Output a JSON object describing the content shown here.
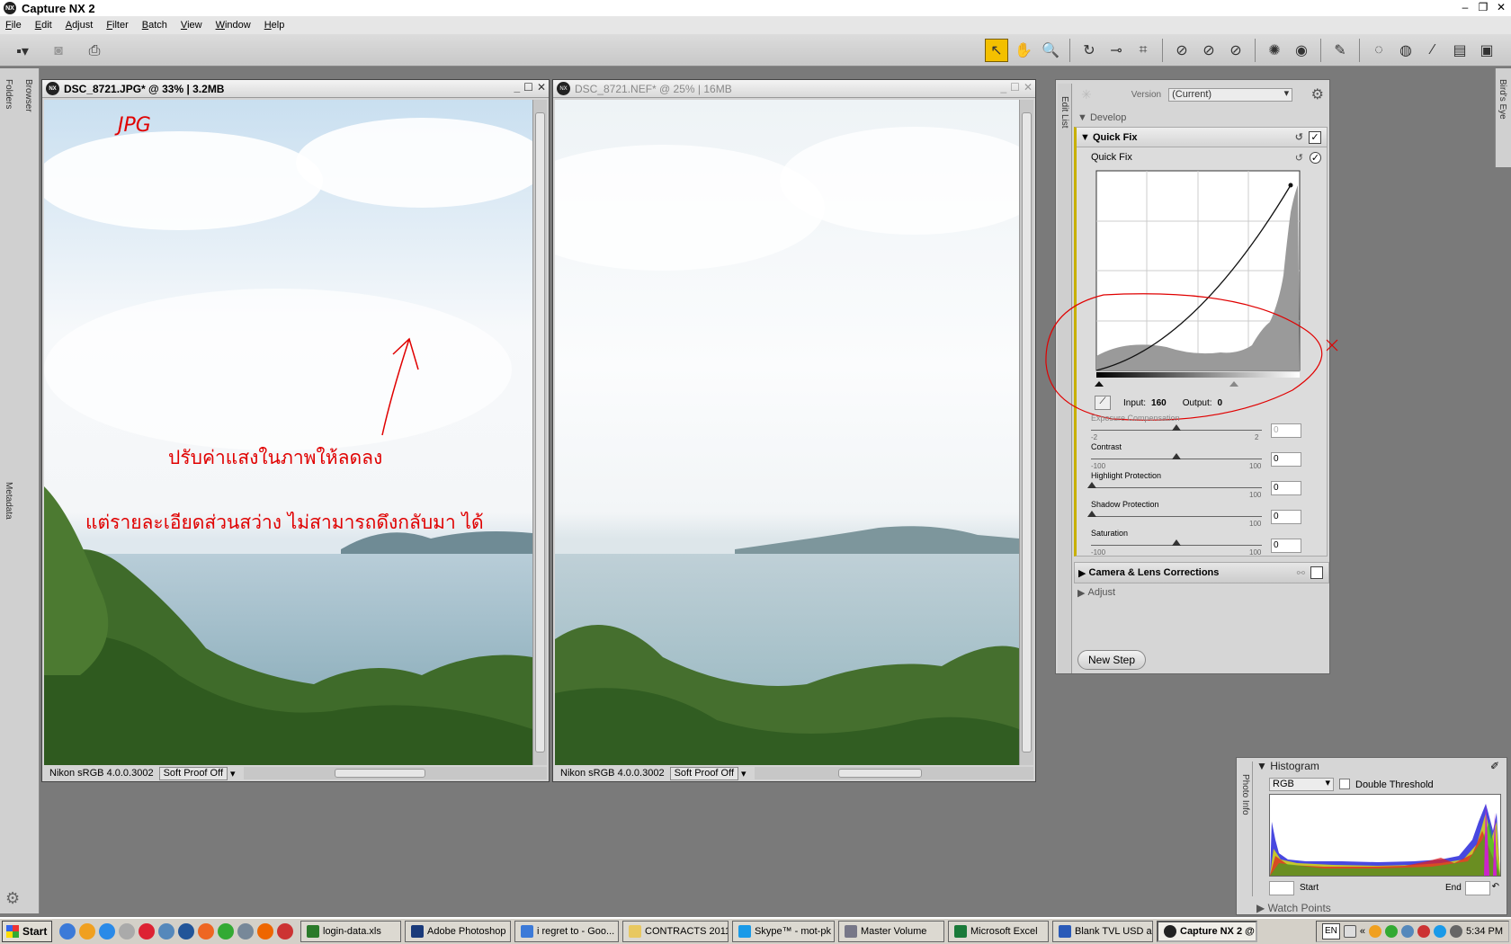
{
  "app": {
    "title": "Capture NX 2",
    "icon_label": "NX"
  },
  "menu": [
    "File",
    "Edit",
    "Adjust",
    "Filter",
    "Batch",
    "View",
    "Window",
    "Help"
  ],
  "side_tabs": {
    "folders": "Folders",
    "browser": "Browser",
    "metadata": "Metadata",
    "birds_eye": "Bird's Eye",
    "edit_list": "Edit List",
    "photo_info": "Photo Info"
  },
  "win1": {
    "title": "DSC_8721.JPG* @ 33% | 3.2MB",
    "profile": "Nikon sRGB 4.0.0.3002",
    "proof": "Soft Proof Off",
    "annot_jpg": "JPG",
    "annot_line1": "ปรับค่าแสงในภาพให้ลดลง",
    "annot_line2": "แต่รายละเอียดส่วนสว่าง ไม่สามารถดึงกลับมา ได้"
  },
  "win2": {
    "title": "DSC_8721.NEF* @ 25% | 16MB",
    "profile": "Nikon sRGB 4.0.0.3002",
    "proof": "Soft Proof Off"
  },
  "edit_list": {
    "version_label": "Version",
    "version_value": "(Current)",
    "develop": "Develop",
    "quick_fix_header": "Quick Fix",
    "quick_fix_sub": "Quick Fix",
    "input_label": "Input:",
    "input_value": "160",
    "output_label": "Output:",
    "output_value": "0",
    "sliders": [
      {
        "label": "Exposure Compensation",
        "min": "-2",
        "max": "2",
        "value": "0"
      },
      {
        "label": "Contrast",
        "min": "-100",
        "max": "100",
        "value": "0"
      },
      {
        "label": "Highlight Protection",
        "min": "",
        "max": "100",
        "value": "0"
      },
      {
        "label": "Shadow Protection",
        "min": "",
        "max": "100",
        "value": "0"
      },
      {
        "label": "Saturation",
        "min": "-100",
        "max": "100",
        "value": "0"
      }
    ],
    "camera_lens": "Camera & Lens Corrections",
    "adjust": "Adjust",
    "new_step": "New Step"
  },
  "histogram": {
    "title": "Histogram",
    "channel": "RGB",
    "double_threshold": "Double Threshold",
    "start_label": "Start",
    "end_label": "End",
    "watch_points": "Watch Points"
  },
  "taskbar": {
    "start": "Start",
    "tasks": [
      "login-data.xls",
      "Adobe Photoshop",
      "i regret to - Goo...",
      "CONTRACTS 2011",
      "Skype™ - mot-pk",
      "Master Volume",
      "Microsoft Excel",
      "Blank TVL USD a...",
      "Capture NX 2 @"
    ],
    "lang": "EN",
    "clock": "5:34 PM"
  },
  "colors": {
    "annotation": "#e00000",
    "active_tool": "#f3c000",
    "title_bg": "#ffffff"
  }
}
